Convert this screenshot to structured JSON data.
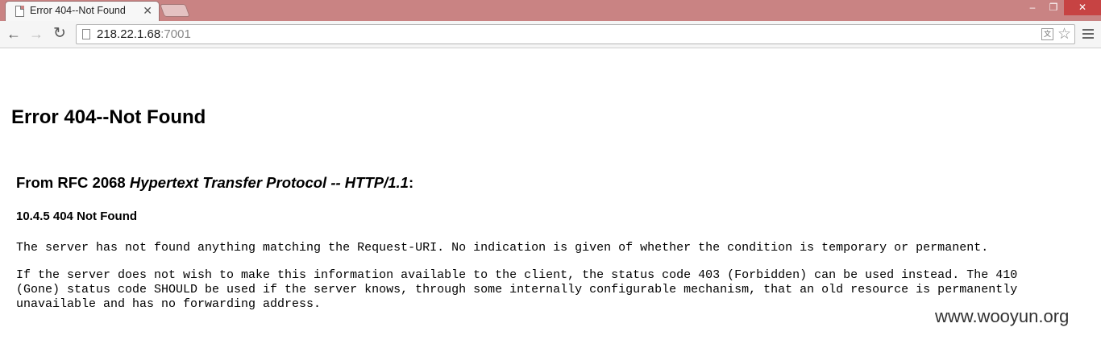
{
  "browser": {
    "tab_title": "Error 404--Not Found",
    "tab_close": "✕",
    "url_host": "218.22.1.68",
    "url_port": ":7001",
    "window_buttons": {
      "minimize": "–",
      "restore": "❐",
      "close": "✕"
    }
  },
  "page": {
    "heading": "Error 404--Not Found",
    "rfc_prefix": "From RFC 2068 ",
    "rfc_title": "Hypertext Transfer Protocol -- HTTP/1.1",
    "rfc_suffix": ":",
    "section_heading": "10.4.5 404 Not Found",
    "paragraph_1": "The server has not found anything matching the Request-URI. No indication is given of whether the condition is temporary or permanent.",
    "paragraph_2_line_1": "If the server does not wish to make this information available to the client, the status code 403 (Forbidden) can be used instead. The 410",
    "paragraph_2_line_2": "(Gone) status code SHOULD be used if the server knows, through some internally configurable mechanism, that an old resource is permanently",
    "paragraph_2_line_3": "unavailable and has no forwarding address.",
    "watermark": "www.wooyun.org"
  },
  "icons": [
    "page-icon",
    "back-arrow-icon",
    "forward-arrow-icon",
    "reload-icon",
    "translate-icon",
    "star-icon",
    "menu-icon",
    "close-icon"
  ]
}
